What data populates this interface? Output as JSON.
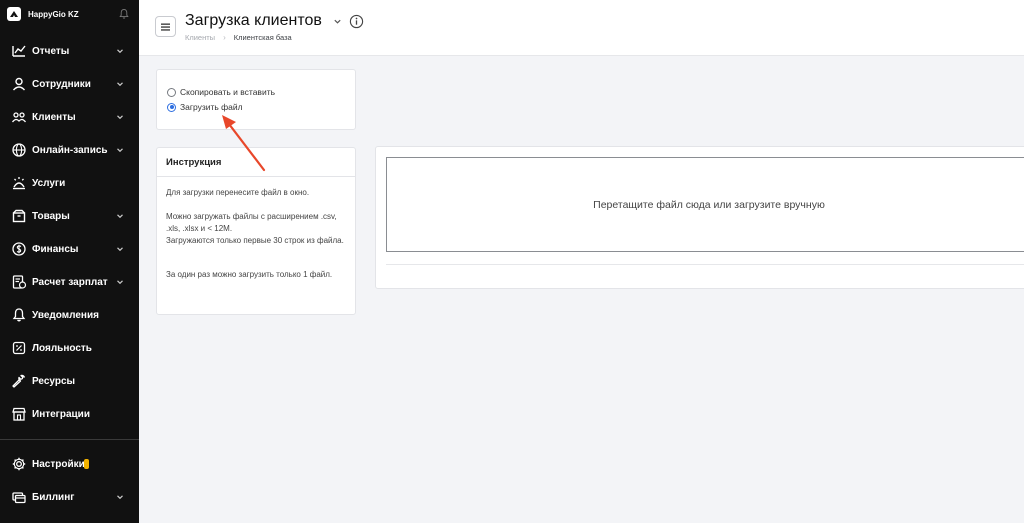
{
  "brand": {
    "name": "HappyGio KZ"
  },
  "nav": [
    {
      "label": "Отчеты",
      "icon": "chart-icon",
      "chevron": true
    },
    {
      "label": "Сотрудники",
      "icon": "user-icon",
      "chevron": true
    },
    {
      "label": "Клиенты",
      "icon": "clients-icon",
      "chevron": true
    },
    {
      "label": "Онлайн-запись",
      "icon": "globe-icon",
      "chevron": true
    },
    {
      "label": "Услуги",
      "icon": "services-icon",
      "chevron": false
    },
    {
      "label": "Товары",
      "icon": "box-icon",
      "chevron": true
    },
    {
      "label": "Финансы",
      "icon": "dollar-icon",
      "chevron": true
    },
    {
      "label": "Расчет зарплат",
      "icon": "payroll-icon",
      "chevron": true
    },
    {
      "label": "Уведомления",
      "icon": "bell-icon",
      "chevron": false
    },
    {
      "label": "Лояльность",
      "icon": "loyalty-icon",
      "chevron": false
    },
    {
      "label": "Ресурсы",
      "icon": "wrench-icon",
      "chevron": false
    },
    {
      "label": "Интеграции",
      "icon": "store-icon",
      "chevron": false
    }
  ],
  "nav_bottom": [
    {
      "label": "Настройки",
      "icon": "gear-icon",
      "chevron": false,
      "badge": true
    },
    {
      "label": "Биллинг",
      "icon": "billing-icon",
      "chevron": true
    }
  ],
  "header": {
    "title": "Загрузка клиентов",
    "breadcrumb": [
      "Клиенты",
      "Клиентская база"
    ]
  },
  "import_mode": {
    "options": [
      {
        "label": "Скопировать и вставить",
        "checked": false
      },
      {
        "label": "Загрузить файл",
        "checked": true
      }
    ]
  },
  "instruction": {
    "title": "Инструкция",
    "paragraphs": [
      "Для загрузки перенесите файл в окно.",
      "Можно загружать файлы с расширением .csv, .xls, .xlsx и < 12M.\nЗагружаются только первые 30 строк из файла.",
      "За один раз можно загрузить только 1 файл."
    ]
  },
  "upload": {
    "dropzone_text": "Перетащите файл сюда или загрузите вручную"
  },
  "colors": {
    "sidebar_bg": "#111111",
    "accent": "#2f6fe0",
    "arrow": "#e8472a",
    "badge": "#f5b400"
  }
}
